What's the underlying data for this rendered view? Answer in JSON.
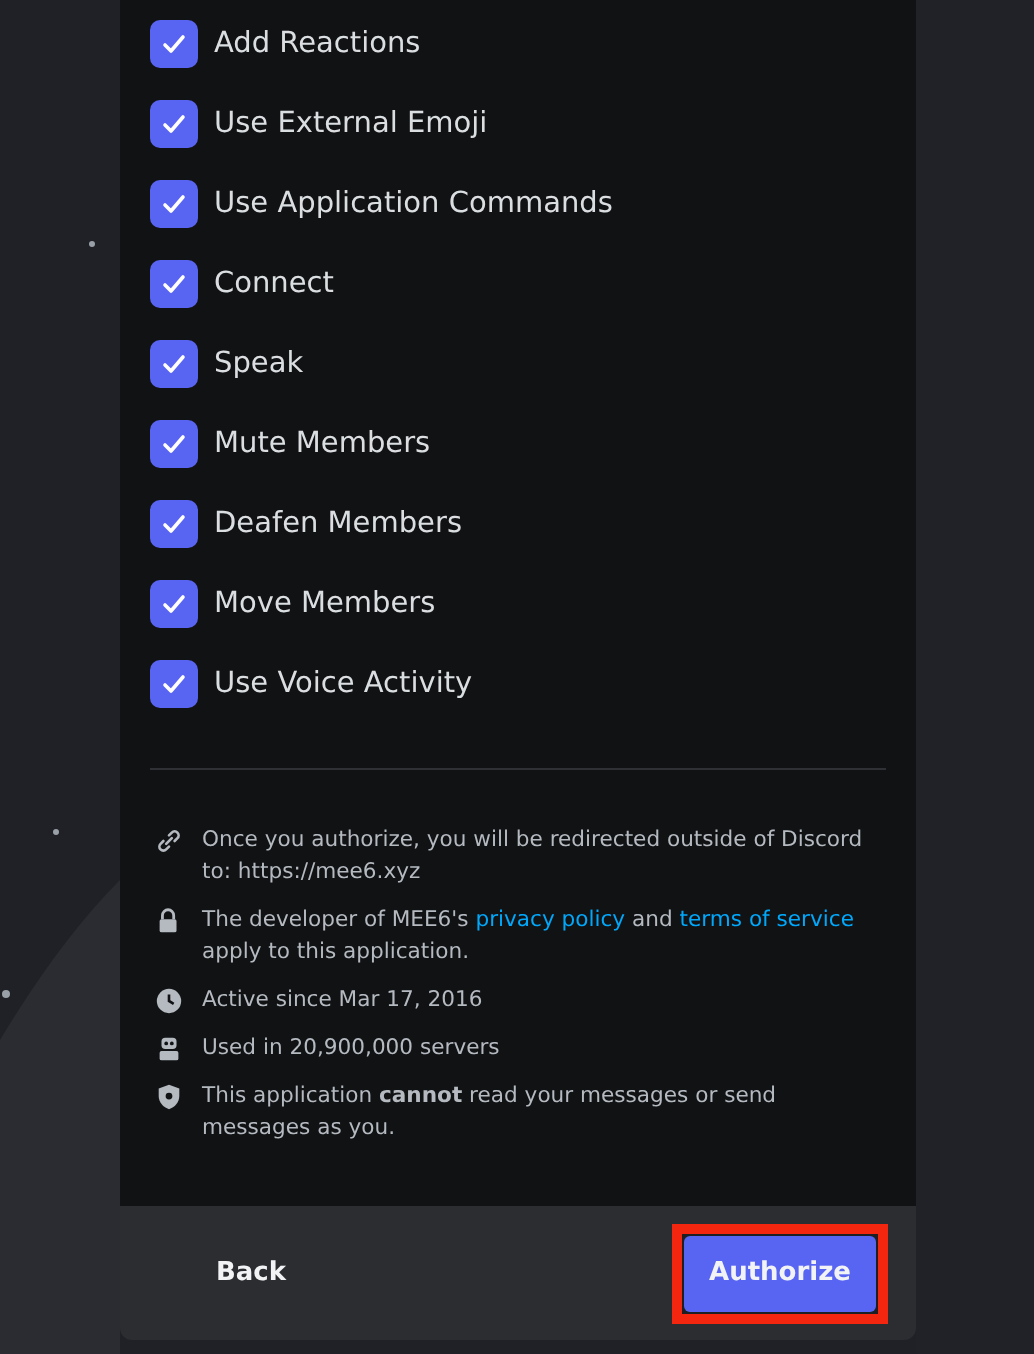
{
  "permissions": [
    {
      "label": "Add Reactions",
      "checked": true
    },
    {
      "label": "Use External Emoji",
      "checked": true
    },
    {
      "label": "Use Application Commands",
      "checked": true
    },
    {
      "label": "Connect",
      "checked": true
    },
    {
      "label": "Speak",
      "checked": true
    },
    {
      "label": "Mute Members",
      "checked": true
    },
    {
      "label": "Deafen Members",
      "checked": true
    },
    {
      "label": "Move Members",
      "checked": true
    },
    {
      "label": "Use Voice Activity",
      "checked": true
    }
  ],
  "notes": [
    {
      "kind": "link",
      "parts": [
        {
          "kind": "text",
          "text": "Once you authorize, you will be redirected outside of Discord to: https://mee6.xyz"
        }
      ]
    },
    {
      "kind": "lock",
      "parts": [
        {
          "kind": "text",
          "text": "The developer of MEE6's "
        },
        {
          "kind": "link",
          "text": "privacy policy"
        },
        {
          "kind": "text",
          "text": " and "
        },
        {
          "kind": "link",
          "text": "terms of service"
        },
        {
          "kind": "text",
          "text": " apply to this application."
        }
      ]
    },
    {
      "kind": "clock",
      "parts": [
        {
          "kind": "text",
          "text": "Active since Mar 17, 2016"
        }
      ]
    },
    {
      "kind": "robot",
      "parts": [
        {
          "kind": "text",
          "text": "Used in 20,900,000 servers"
        }
      ]
    },
    {
      "kind": "shield",
      "parts": [
        {
          "kind": "text",
          "text": "This application **cannot** read your messages or send messages as you."
        }
      ]
    }
  ],
  "footer": {
    "back": "Back",
    "authorize": {
      "label": "Authorize",
      "highlighted": true
    }
  }
}
